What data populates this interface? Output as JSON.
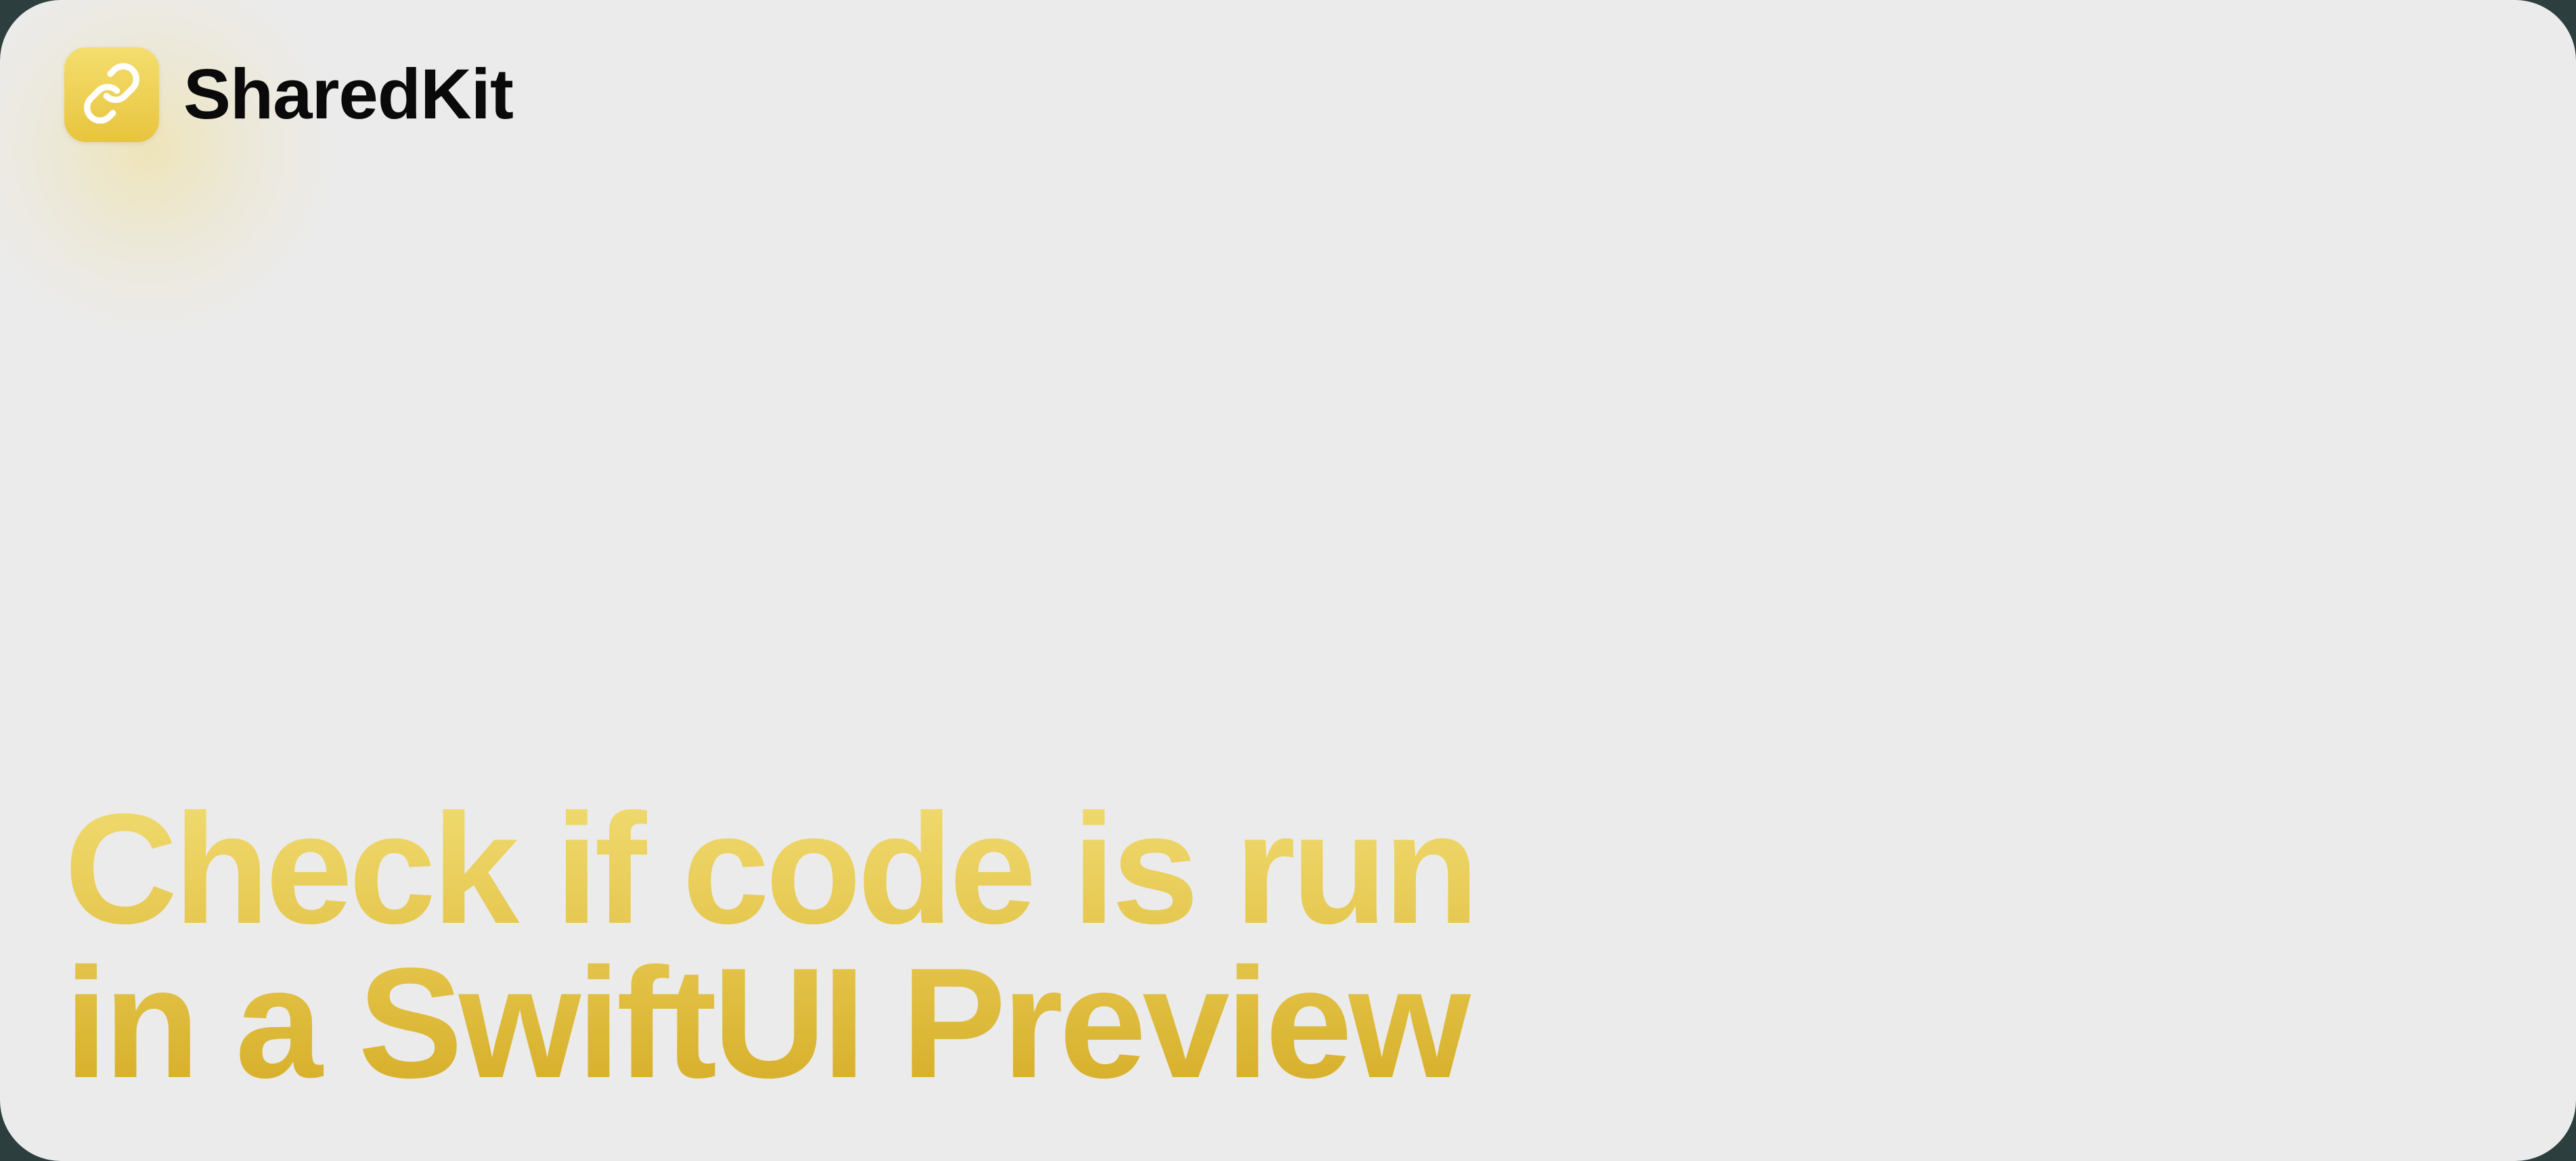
{
  "app": {
    "name": "SharedKit",
    "icon_name": "link-icon"
  },
  "headline": {
    "line1": "Check if code is run",
    "line2": "in a SwiftUI Preview"
  },
  "colors": {
    "card_background": "#ebebeb",
    "accent_gradient_top": "#f0db70",
    "accent_gradient_bottom": "#d6ae28",
    "icon_gradient_top": "#f4de6e",
    "icon_gradient_bottom": "#e8c43e"
  }
}
